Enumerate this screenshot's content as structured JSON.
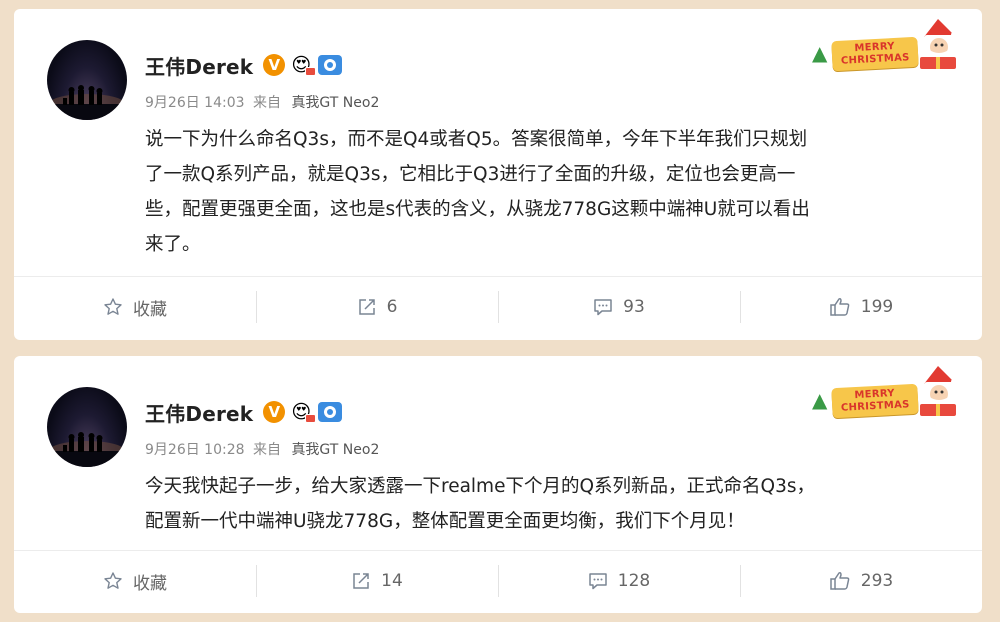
{
  "posts": [
    {
      "author": "王伟Derek",
      "verified_badge": "V",
      "date": "9月26日 14:03",
      "from_label": "来自",
      "source": "真我GT Neo2",
      "text_lines": [
        "说一下为什么命名Q3s，而不是Q4或者Q5。答案很简单，今年下半年我们只规划",
        "了一款Q系列产品，就是Q3s，它相比于Q3进行了全面的升级，定位也会更高一",
        "些，配置更强更全面，这也是s代表的含义，从骁龙778G这颗中端神U就可以看出",
        "来了。"
      ],
      "actions": {
        "favorite_label": "收藏",
        "reposts": "6",
        "comments": "93",
        "likes": "199"
      }
    },
    {
      "author": "王伟Derek",
      "verified_badge": "V",
      "date": "9月26日 10:28",
      "from_label": "来自",
      "source": "真我GT Neo2",
      "text_lines": [
        "今天我快起子一步，给大家透露一下realme下个月的Q系列新品，正式命名Q3s，",
        "配置新一代中端神U骁龙778G，整体配置更全面更均衡，我们下个月见！"
      ],
      "actions": {
        "favorite_label": "收藏",
        "reposts": "14",
        "comments": "128",
        "likes": "293"
      }
    }
  ],
  "decoration": {
    "xmas_line1": "MERRY",
    "xmas_line2": "CHRISTMAS"
  },
  "icons": {
    "favorite": "star-icon",
    "repost": "repost-icon",
    "comment": "comment-icon",
    "like": "thumbs-up-icon"
  },
  "colors": {
    "page_background": "#f0dfc9",
    "card_background": "#ffffff",
    "verified_badge": "#f29100",
    "camera_badge": "#3a8ce0"
  }
}
